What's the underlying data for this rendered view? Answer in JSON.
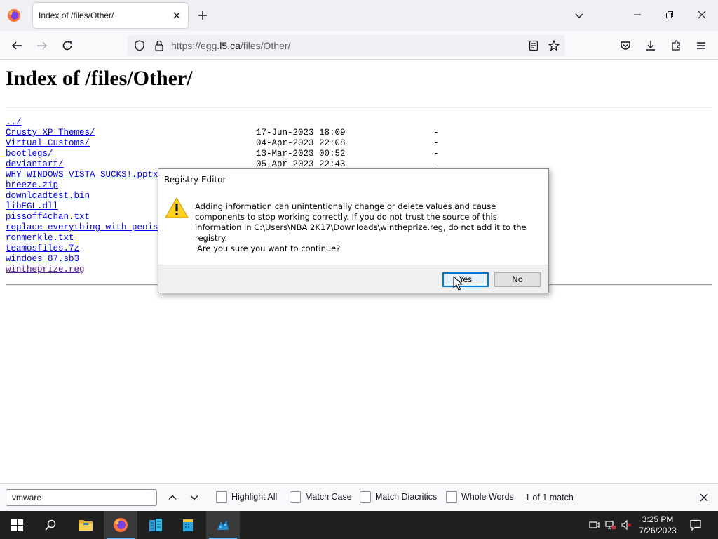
{
  "browser": {
    "tab_title": "Index of /files/Other/",
    "url_prefix": "https://egg.",
    "url_host": "l5.ca",
    "url_path": "/files/Other/"
  },
  "page": {
    "heading": "Index of /files/Other/",
    "entries": [
      {
        "name": "../",
        "date": "",
        "size": "",
        "visited": false
      },
      {
        "name": "Crusty XP Themes/",
        "date": "17-Jun-2023 18:09",
        "size": "-",
        "visited": false
      },
      {
        "name": "Virtual Customs/",
        "date": "04-Apr-2023 22:08",
        "size": "-",
        "visited": false
      },
      {
        "name": "bootlegs/",
        "date": "13-Mar-2023 00:52",
        "size": "-",
        "visited": false
      },
      {
        "name": "deviantart/",
        "date": "05-Apr-2023 22:43",
        "size": "-",
        "visited": false
      },
      {
        "name": "WHY WINDOWS VISTA SUCKS!.pptx",
        "date": "",
        "size": "",
        "visited": false
      },
      {
        "name": "breeze.zip",
        "date": "",
        "size": "",
        "visited": false
      },
      {
        "name": "downloadtest.bin",
        "date": "",
        "size": "",
        "visited": false
      },
      {
        "name": "libEGL.dll",
        "date": "",
        "size": "",
        "visited": false
      },
      {
        "name": "pissoff4chan.txt",
        "date": "",
        "size": "",
        "visited": false
      },
      {
        "name": "replace everything with penis.j",
        "date": "",
        "size": "",
        "visited": false
      },
      {
        "name": "ronmerkle.txt",
        "date": "",
        "size": "",
        "visited": false
      },
      {
        "name": "teamosfiles.7z",
        "date": "",
        "size": "",
        "visited": false
      },
      {
        "name": "windoes 87.sb3",
        "date": "",
        "size": "",
        "visited": false
      },
      {
        "name": "wintheprize.reg",
        "date": "",
        "size": "",
        "visited": true
      }
    ]
  },
  "dialog": {
    "title": "Registry Editor",
    "message": "Adding information can unintentionally change or delete values and cause components to stop working correctly. If you do not trust the source of this information in C:\\Users\\NBA 2K17\\Downloads\\wintheprize.reg, do not add it to the registry.",
    "question": "Are you sure you want to continue?",
    "yes_label": "Yes",
    "no_label": "No"
  },
  "findbar": {
    "query": "vmware",
    "highlight_all": "Highlight All",
    "match_case": "Match Case",
    "match_diacritics": "Match Diacritics",
    "whole_words": "Whole Words",
    "status": "1 of 1 match"
  },
  "taskbar": {
    "time": "3:25 PM",
    "date": "7/26/2023"
  },
  "colors": {
    "link": "#0000ee",
    "visited": "#551a8b",
    "taskbar": "#1f1f1f",
    "accent": "#0078d7"
  }
}
